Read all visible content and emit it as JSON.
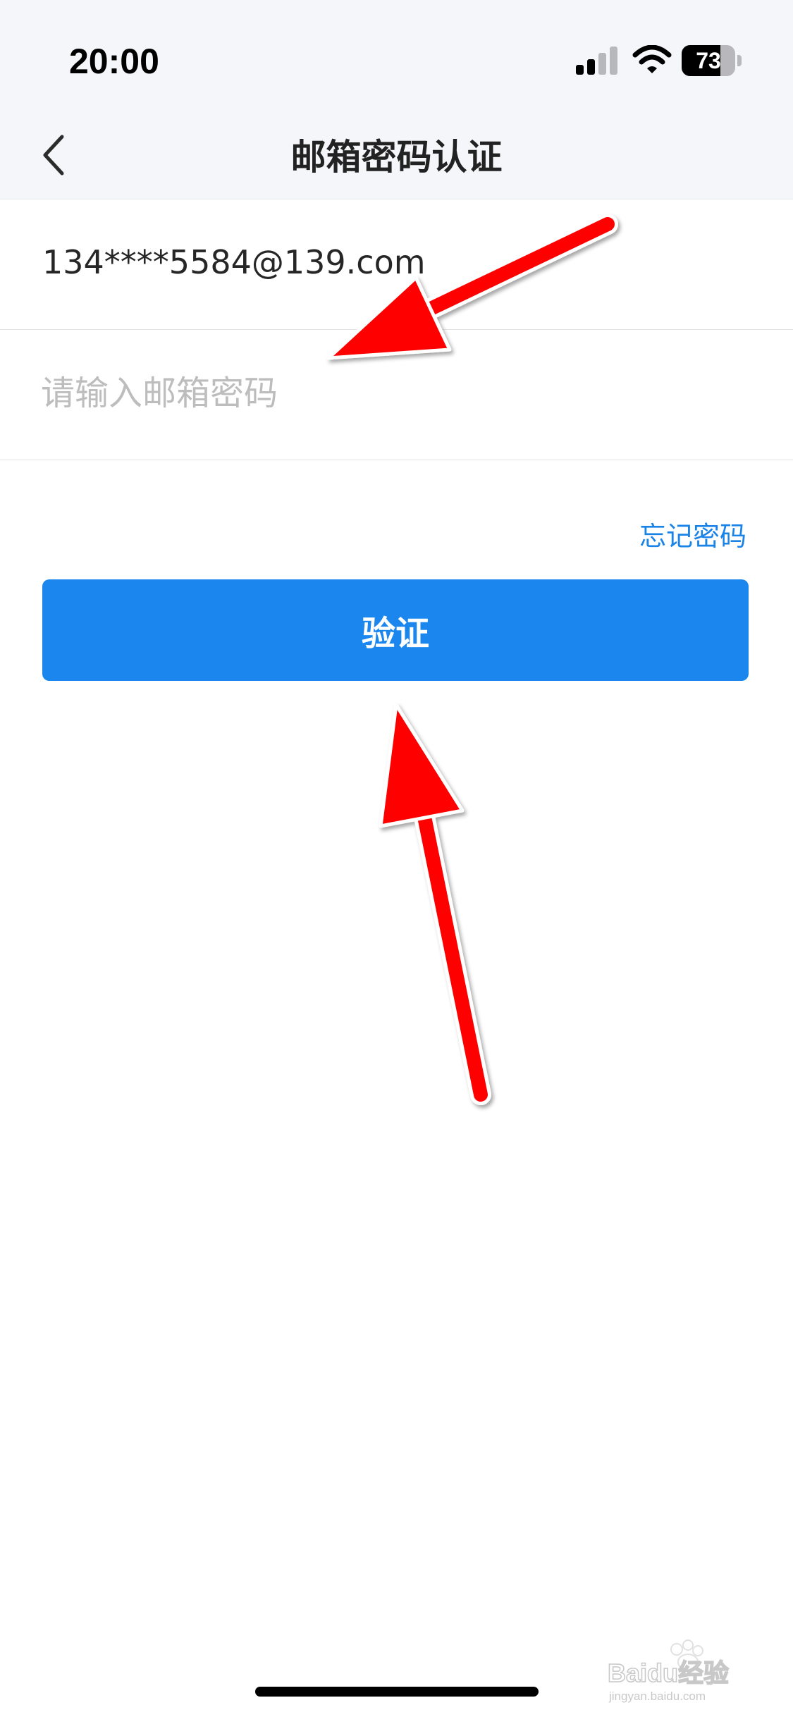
{
  "status_bar": {
    "time": "20:00",
    "battery_percent": "73",
    "battery_level": 0.73,
    "icons": [
      "signal-icon",
      "wifi-icon",
      "battery-icon"
    ]
  },
  "nav": {
    "title": "邮箱密码认证",
    "back_icon": "chevron-left-icon"
  },
  "form": {
    "email": "134****5584@139.com",
    "password_value": "",
    "password_placeholder": "请输入邮箱密码",
    "forgot_label": "忘记密码",
    "submit_label": "验证"
  },
  "watermark": {
    "text": "Baidu经验",
    "subtext": "jingyan.baidu.com"
  },
  "colors": {
    "accent": "#1a86ee",
    "link": "#1a83e8",
    "annotation_arrow": "#ff0000",
    "header_bg": "#f5f6f9"
  }
}
